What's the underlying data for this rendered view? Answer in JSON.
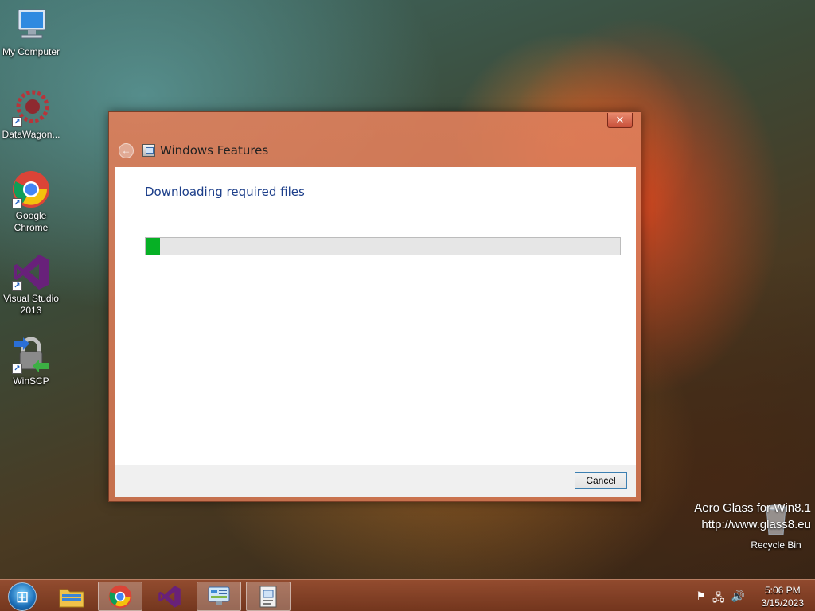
{
  "desktop": {
    "icons": [
      {
        "label": "My Computer",
        "icon": "computer-icon"
      },
      {
        "label": "DataWagon...",
        "icon": "datawagon-icon"
      },
      {
        "label": "Google Chrome",
        "icon": "chrome-icon"
      },
      {
        "label": "Visual Studio 2013",
        "icon": "visual-studio-icon"
      },
      {
        "label": "WinSCP",
        "icon": "winscp-icon"
      }
    ],
    "recycle_bin": {
      "label": "Recycle Bin",
      "icon": "recycle-bin-icon"
    }
  },
  "dialog": {
    "title": "Windows Features",
    "close_label": "✕",
    "back_icon": "back-arrow-icon",
    "heading": "Downloading required files",
    "progress_fraction": 0.03,
    "cancel_label": "Cancel"
  },
  "watermark": {
    "line1": "Aero Glass for Win8.1",
    "line2": "http://www.glass8.eu"
  },
  "taskbar": {
    "items": [
      {
        "name": "start-button",
        "icon": "windows-logo-icon"
      },
      {
        "name": "file-explorer",
        "icon": "folder-icon"
      },
      {
        "name": "google-chrome",
        "icon": "chrome-icon"
      },
      {
        "name": "visual-studio",
        "icon": "visual-studio-icon"
      },
      {
        "name": "control-panel",
        "icon": "control-panel-icon"
      },
      {
        "name": "windows-features",
        "icon": "windows-features-icon"
      }
    ],
    "tray_icons": [
      "flag-icon",
      "network-icon",
      "speaker-icon"
    ],
    "time": "5:06 PM",
    "date": "3/15/2023"
  },
  "colors": {
    "progress_green": "#06b025",
    "heading_blue": "#1d3f8a",
    "dialog_frame": "#de7e5a"
  }
}
